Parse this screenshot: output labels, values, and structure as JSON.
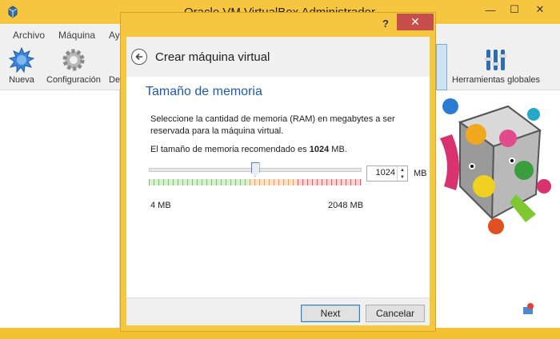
{
  "main_window": {
    "title": "Oracle VM VirtualBox Administrador",
    "menu": [
      "Archivo",
      "Máquina",
      "Ay"
    ],
    "toolbar": {
      "new_label": "Nueva",
      "settings_label": "Configuración",
      "third_label": "De",
      "global_tools_label": "Herramientas globales"
    }
  },
  "dialog": {
    "help": "?",
    "close": "✕",
    "title": "Crear máquina virtual",
    "page_title": "Tamaño de memoria",
    "description": "Seleccione la cantidad de memoria (RAM) en megabytes a ser reservada para la máquina virtual.",
    "recommend_prefix": "El tamaño de memoria recomendado es",
    "recommend_value": "1024",
    "recommend_suffix": "MB.",
    "memory": {
      "value": "1024",
      "unit": "MB",
      "min_label": "4 MB",
      "max_label": "2048 MB",
      "slider_fraction": 0.5
    },
    "buttons": {
      "next": "Next",
      "cancel": "Cancelar"
    }
  },
  "colors": {
    "titlebar": "#f7c640",
    "close": "#c74f4b",
    "page_title": "#1e5aa8"
  }
}
